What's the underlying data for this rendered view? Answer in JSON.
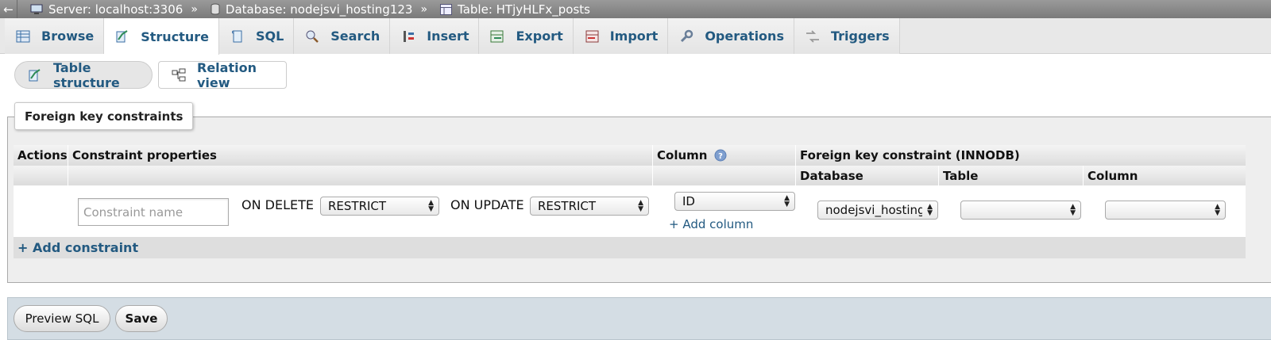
{
  "breadcrumb": {
    "server": "Server: localhost:3306",
    "database": "Database: nodejsvi_hosting123",
    "table": "Table: HTjyHLFx_posts",
    "separator": "»"
  },
  "tabs": [
    {
      "label": "Browse",
      "icon": "browse-icon"
    },
    {
      "label": "Structure",
      "icon": "structure-icon",
      "active": true
    },
    {
      "label": "SQL",
      "icon": "sql-icon"
    },
    {
      "label": "Search",
      "icon": "search-icon"
    },
    {
      "label": "Insert",
      "icon": "insert-icon"
    },
    {
      "label": "Export",
      "icon": "export-icon"
    },
    {
      "label": "Import",
      "icon": "import-icon"
    },
    {
      "label": "Operations",
      "icon": "operations-icon"
    },
    {
      "label": "Triggers",
      "icon": "triggers-icon"
    }
  ],
  "subtabs": {
    "table_structure": "Table structure",
    "relation_view": "Relation view"
  },
  "fieldset": {
    "legend": "Foreign key constraints"
  },
  "table": {
    "headers": {
      "actions": "Actions",
      "constraint_properties": "Constraint properties",
      "column": "Column",
      "fk_constraint": "Foreign key constraint (INNODB)",
      "database": "Database",
      "table": "Table",
      "ref_column": "Column"
    },
    "row": {
      "constraint_name_placeholder": "Constraint name",
      "on_delete_label": "ON DELETE",
      "on_delete_value": "RESTRICT",
      "on_update_label": "ON UPDATE",
      "on_update_value": "RESTRICT",
      "column_value": "ID",
      "add_column": "+ Add column",
      "database_value": "nodejsvi_hosting",
      "table_value": "",
      "ref_column_value": ""
    },
    "add_constraint": "+ Add constraint"
  },
  "footer": {
    "preview_sql": "Preview SQL",
    "save": "Save"
  }
}
